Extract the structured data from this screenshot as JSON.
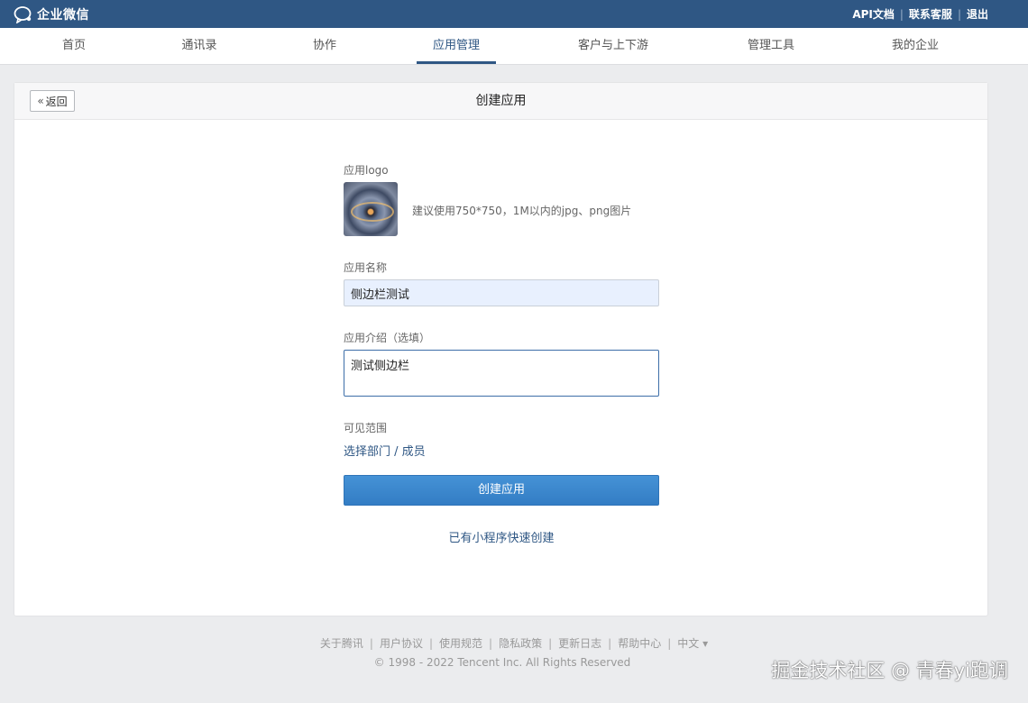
{
  "topbar": {
    "brand": "企业微信",
    "links": [
      "API文档",
      "联系客服",
      "退出"
    ]
  },
  "nav": {
    "items": [
      "首页",
      "通讯录",
      "协作",
      "应用管理",
      "客户与上下游",
      "管理工具",
      "我的企业"
    ],
    "active": "应用管理"
  },
  "card": {
    "back_label": "返回",
    "title": "创建应用"
  },
  "form": {
    "logo_label": "应用logo",
    "logo_hint": "建议使用750*750，1M以内的jpg、png图片",
    "name_label": "应用名称",
    "name_value": "侧边栏测试",
    "desc_label": "应用介绍（选填）",
    "desc_value": "测试侧边栏",
    "visible_label": "可见范围",
    "visible_link": "选择部门 / 成员",
    "create_button": "创建应用",
    "mini_program_link": "已有小程序快速创建"
  },
  "footer": {
    "links": [
      "关于腾讯",
      "用户协议",
      "使用规范",
      "隐私政策",
      "更新日志",
      "帮助中心",
      "中文 ▾"
    ],
    "copyright": "© 1998 - 2022 Tencent Inc. All Rights Reserved"
  },
  "watermark": "掘金技术社区 @ 青春yi跑调",
  "colors": {
    "topbar": "#2f5784",
    "accent": "#2f5784",
    "button": "#3a86cc"
  }
}
